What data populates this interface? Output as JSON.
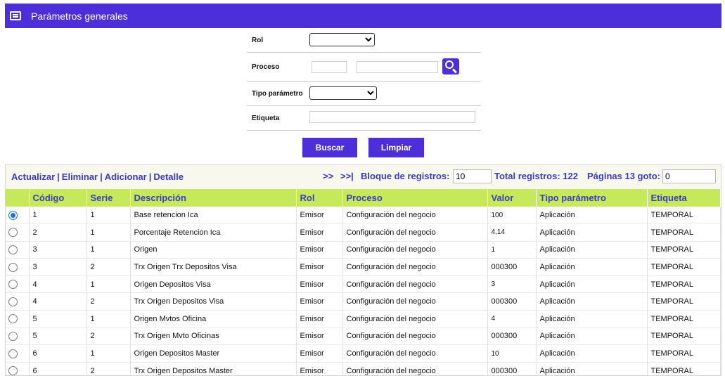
{
  "header": {
    "title": "Parámetros generales",
    "icon": "list-window-icon"
  },
  "form": {
    "rol_label": "Rol",
    "proceso_label": "Proceso",
    "tipo_label": "Tipo parámetro",
    "etiqueta_label": "Etiqueta",
    "rol_value": "",
    "proceso_code": "",
    "proceso_desc": "",
    "tipo_value": "",
    "etiqueta_value": "",
    "search_icon": "magnifier-icon",
    "buscar": "Buscar",
    "limpiar": "Limpiar"
  },
  "toolbar": {
    "actualizar": "Actualizar",
    "eliminar": "Eliminar",
    "adicionar": "Adicionar",
    "detalle": "Detalle",
    "sep": "|",
    "next": ">>",
    "last": ">>|",
    "bloque_label": "Bloque de registros:",
    "bloque_value": "10",
    "total_label": "Total registros: 122",
    "paginas_label": "Páginas 13 goto:",
    "goto_value": "0"
  },
  "table": {
    "headers": [
      "Código",
      "Serie",
      "Descripción",
      "Rol",
      "Proceso",
      "Valor",
      "Tipo parámetro",
      "Etiqueta"
    ],
    "rows": [
      {
        "selected": true,
        "codigo": "1",
        "serie": "1",
        "descripcion": "Base retencion Ica",
        "rol": "Emisor",
        "proceso": "Configuración del negocio",
        "valor": "100",
        "tipo": "Aplicación",
        "etiqueta": "TEMPORAL"
      },
      {
        "selected": false,
        "codigo": "2",
        "serie": "1",
        "descripcion": "Porcentaje Retencion Ica",
        "rol": "Emisor",
        "proceso": "Configuración del negocio",
        "valor": "4,14",
        "tipo": "Aplicación",
        "etiqueta": "TEMPORAL"
      },
      {
        "selected": false,
        "codigo": "3",
        "serie": "1",
        "descripcion": "Origen",
        "rol": "Emisor",
        "proceso": "Configuración del negocio",
        "valor": "1",
        "tipo": "Aplicación",
        "etiqueta": "TEMPORAL"
      },
      {
        "selected": false,
        "codigo": "3",
        "serie": "2",
        "descripcion": "Trx Origen Trx Depositos Visa",
        "rol": "Emisor",
        "proceso": "Configuración del negocio",
        "valor": "000300",
        "tipo": "Aplicación",
        "etiqueta": "TEMPORAL"
      },
      {
        "selected": false,
        "codigo": "4",
        "serie": "1",
        "descripcion": "Origen Depositos Visa",
        "rol": "Emisor",
        "proceso": "Configuración del negocio",
        "valor": "3",
        "tipo": "Aplicación",
        "etiqueta": "TEMPORAL"
      },
      {
        "selected": false,
        "codigo": "4",
        "serie": "2",
        "descripcion": "Trx Origen Depositos Visa",
        "rol": "Emisor",
        "proceso": "Configuración del negocio",
        "valor": "000300",
        "tipo": "Aplicación",
        "etiqueta": "TEMPORAL"
      },
      {
        "selected": false,
        "codigo": "5",
        "serie": "1",
        "descripcion": "Origen Mvtos Oficina",
        "rol": "Emisor",
        "proceso": "Configuración del negocio",
        "valor": "4",
        "tipo": "Aplicación",
        "etiqueta": "TEMPORAL"
      },
      {
        "selected": false,
        "codigo": "5",
        "serie": "2",
        "descripcion": "Trx Origen Mvto Oficinas",
        "rol": "Emisor",
        "proceso": "Configuración del negocio",
        "valor": "000300",
        "tipo": "Aplicación",
        "etiqueta": "TEMPORAL"
      },
      {
        "selected": false,
        "codigo": "6",
        "serie": "1",
        "descripcion": "Origen Depositos Master",
        "rol": "Emisor",
        "proceso": "Configuración del negocio",
        "valor": "10",
        "tipo": "Aplicación",
        "etiqueta": "TEMPORAL"
      },
      {
        "selected": false,
        "codigo": "6",
        "serie": "2",
        "descripcion": "Trx Origen Depositos Master",
        "rol": "Emisor",
        "proceso": "Configuración del negocio",
        "valor": "000300",
        "tipo": "Aplicación",
        "etiqueta": "TEMPORAL"
      }
    ]
  }
}
